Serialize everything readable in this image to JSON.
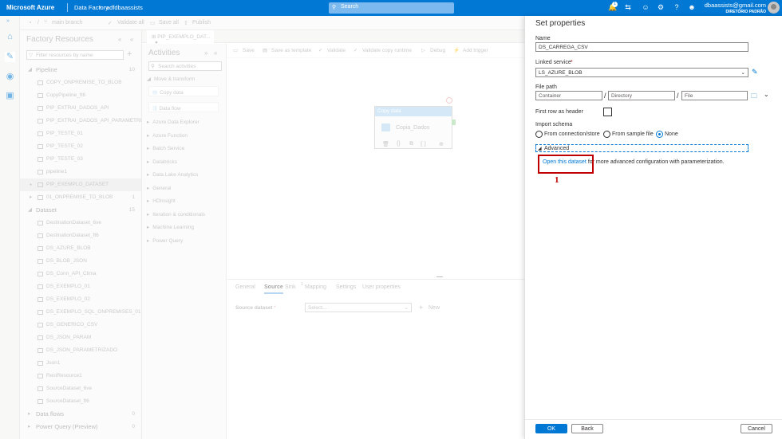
{
  "topbar": {
    "brand": "Microsoft Azure",
    "service": "Data Factory",
    "factory": "adfdbaassists",
    "search_placeholder": "Search",
    "notification_count": "1",
    "user_email": "dbaassists@gmail.com",
    "user_directory": "DIRETÓRIO PADRÃO"
  },
  "toolbar": {
    "branch": "main branch",
    "validate_all": "Validate all",
    "save_all": "Save all",
    "publish": "Publish"
  },
  "factory_resources": {
    "title": "Factory Resources",
    "filter_placeholder": "Filter resources by name",
    "pipeline_section": {
      "label": "Pipeline",
      "count": "10"
    },
    "pipelines": [
      "COPY_ONPREMISE_TO_BLOB",
      "CopyPipeline_ft6",
      "PIP_EXTRAI_DADOS_API",
      "PIP_EXTRAI_DADOS_API_PARAMETRI...",
      "PIP_TESTE_01",
      "PIP_TESTE_02",
      "PIP_TESTE_03",
      "pipeline1",
      "PIP_EXEMPLO_DATASET"
    ],
    "pipeline_folder": {
      "label": "01_ONPREMISE_TO_BLOB",
      "count": "1"
    },
    "dataset_section": {
      "label": "Dataset",
      "count": "15"
    },
    "datasets": [
      "DestinationDataset_6ve",
      "DestinationDataset_ft6",
      "DS_AZURE_BLOB",
      "DS_BLOB_JSON",
      "DS_Conn_API_Clima",
      "DS_EXEMPLO_01",
      "DS_EXEMPLO_02",
      "DS_EXEMPLO_SQL_ONPREMISES_01",
      "DS_GENERICO_CSV",
      "DS_JSON_PARAM",
      "DS_JSON_PARAMETRIZADO",
      "Json1",
      "RestResource1",
      "SourceDataset_6ve",
      "SourceDataset_ft6"
    ],
    "dataflows_section": {
      "label": "Data flows",
      "count": "0"
    },
    "powerquery_section": {
      "label": "Power Query (Preview)",
      "count": "0"
    }
  },
  "pipeline_tab": {
    "label": "PIP_EXEMPLO_DAT..."
  },
  "activities": {
    "title": "Activities",
    "search_placeholder": "Search activities",
    "groups": [
      "Move & transform",
      "Azure Data Explorer",
      "Azure Function",
      "Batch Service",
      "Databricks",
      "Data Lake Analytics",
      "General",
      "HDInsight",
      "Iteration & conditionals",
      "Machine Learning",
      "Power Query"
    ],
    "move_items": [
      "Copy data",
      "Data flow"
    ]
  },
  "canvas_toolbar": {
    "save": "Save",
    "save_template": "Save as template",
    "validate": "Validate",
    "validate_copy": "Validate copy runtime",
    "debug": "Debug",
    "add_trigger": "Add trigger"
  },
  "activity_node": {
    "header": "Copy data",
    "name": "Copia_Dados"
  },
  "bottom_tabs": [
    "General",
    "Source",
    "Sink",
    "Mapping",
    "Settings",
    "User properties"
  ],
  "bottom_tab_sink_badge": "1",
  "source": {
    "label": "Source dataset",
    "select_placeholder": "Select...",
    "new": "New"
  },
  "set_properties": {
    "title": "Set properties",
    "name_label": "Name",
    "name_value": "DS_CARREGA_CSV",
    "linked_service_label": "Linked service",
    "linked_service_value": "LS_AZURE_BLOB",
    "file_path_label": "File path",
    "container_placeholder": "Container",
    "directory_placeholder": "Directory",
    "file_placeholder": "File",
    "first_row_label": "First row as header",
    "import_schema_label": "Import schema",
    "import_options": [
      "From connection/store",
      "From sample file",
      "None"
    ],
    "import_selected": "None",
    "advanced_label": "Advanced",
    "open_dataset_link": "Open this dataset",
    "advanced_text": " for more advanced configuration with parameterization.",
    "annotation_number": "1",
    "ok": "OK",
    "back": "Back",
    "cancel": "Cancel"
  },
  "colors": {
    "accent": "#0078d4",
    "annotation": "#c00000"
  }
}
